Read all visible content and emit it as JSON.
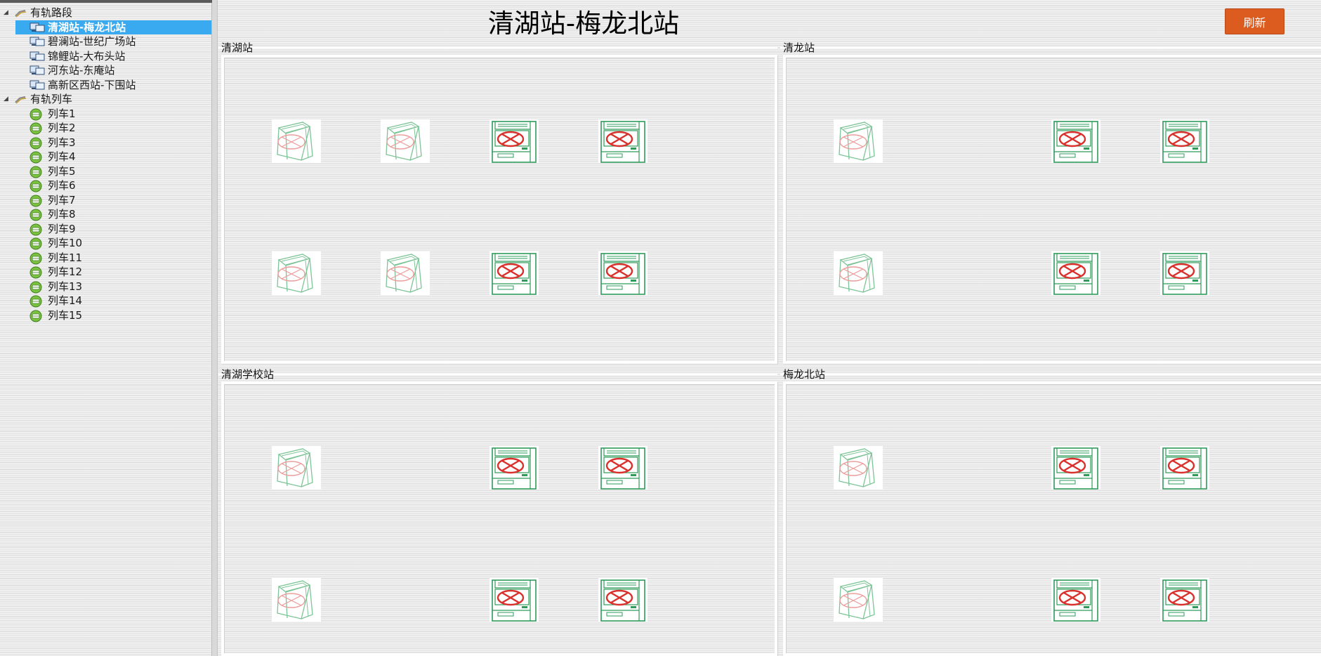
{
  "tree": {
    "sections": [
      {
        "label": "有轨路段",
        "items": [
          {
            "label": "清湖站-梅龙北站",
            "selected": true
          },
          {
            "label": "碧澜站-世纪广场站"
          },
          {
            "label": "锦鲤站-大布头站"
          },
          {
            "label": "河东站-东庵站"
          },
          {
            "label": "高新区西站-下围站"
          }
        ]
      },
      {
        "label": "有轨列车",
        "items": [
          {
            "label": "列车1"
          },
          {
            "label": "列车2"
          },
          {
            "label": "列车3"
          },
          {
            "label": "列车4"
          },
          {
            "label": "列车5"
          },
          {
            "label": "列车6"
          },
          {
            "label": "列车7"
          },
          {
            "label": "列车8"
          },
          {
            "label": "列车9"
          },
          {
            "label": "列车10"
          },
          {
            "label": "列车11"
          },
          {
            "label": "列车12"
          },
          {
            "label": "列车13"
          },
          {
            "label": "列车14"
          },
          {
            "label": "列车15"
          }
        ]
      }
    ]
  },
  "header": {
    "title": "清湖站-梅龙北站",
    "refresh_label": "刷新"
  },
  "panels": [
    {
      "title": "清湖站",
      "devices": [
        {
          "kind": "gate-machine-offline"
        },
        {
          "kind": "gate-machine-offline"
        },
        {
          "kind": "ticket-machine-error"
        },
        {
          "kind": "ticket-machine-error"
        },
        {
          "kind": "gate-machine-offline"
        },
        {
          "kind": "gate-machine-offline"
        },
        {
          "kind": "ticket-machine-error"
        },
        {
          "kind": "ticket-machine-error"
        }
      ]
    },
    {
      "title": "清龙站",
      "devices": [
        {
          "kind": "gate-machine-offline"
        },
        {
          "kind": "ticket-machine-error"
        },
        {
          "kind": "ticket-machine-error"
        },
        {
          "kind": "gate-machine-offline"
        },
        {
          "kind": "ticket-machine-error"
        },
        {
          "kind": "ticket-machine-error"
        }
      ]
    },
    {
      "title": "清湖学校站",
      "devices": [
        {
          "kind": "gate-machine-offline"
        },
        {
          "kind": "ticket-machine-error"
        },
        {
          "kind": "ticket-machine-error"
        },
        {
          "kind": "gate-machine-offline"
        },
        {
          "kind": "ticket-machine-error"
        },
        {
          "kind": "ticket-machine-error"
        }
      ]
    },
    {
      "title": "梅龙北站",
      "devices": [
        {
          "kind": "gate-machine-offline"
        },
        {
          "kind": "ticket-machine-error"
        },
        {
          "kind": "ticket-machine-error"
        },
        {
          "kind": "gate-machine-offline"
        },
        {
          "kind": "ticket-machine-error"
        },
        {
          "kind": "ticket-machine-error"
        }
      ]
    }
  ],
  "colors": {
    "selection": "#39a9f0",
    "accent_button": "#dc5b1f",
    "device_outline": "#2e9b5a",
    "device_outline_faded": "#7cc496",
    "error_mark": "#d9302c",
    "error_mark_faded": "#ec9c9a"
  }
}
